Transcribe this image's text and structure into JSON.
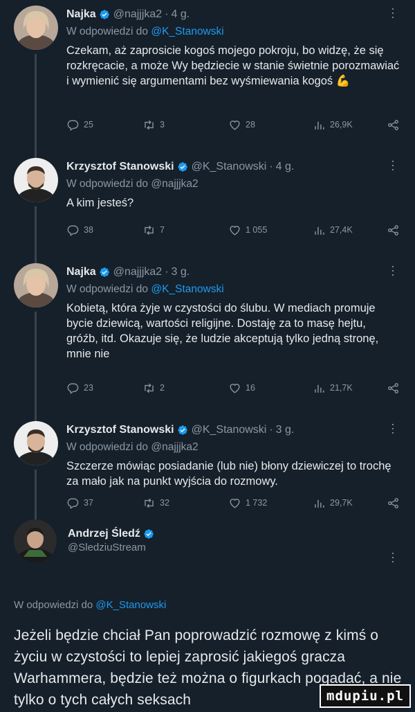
{
  "replying_prefix": "W odpowiedzi do",
  "tweets": [
    {
      "name": "Najka",
      "handle": "@najjjka2",
      "time": "4 g.",
      "reply_to": "@K_Stanowski",
      "reply_to_is_link": true,
      "text": "Czekam, aż zaprosicie kogoś mojego pokroju, bo widzę, że się rozkręcacie, a może Wy będziecie w stanie świetnie porozmawiać i wymienić się argumentami bez wyśmiewania kogoś 💪",
      "replies": "25",
      "retweets": "3",
      "likes": "28",
      "views": "26,9K"
    },
    {
      "name": "Krzysztof Stanowski",
      "handle": "@K_Stanowski",
      "time": "4 g.",
      "reply_to": "@najjjka2",
      "reply_to_is_link": false,
      "text": "A kim jesteś?",
      "replies": "38",
      "retweets": "7",
      "likes": "1 055",
      "views": "27,4K"
    },
    {
      "name": "Najka",
      "handle": "@najjjka2",
      "time": "3 g.",
      "reply_to": "@K_Stanowski",
      "reply_to_is_link": true,
      "text": "Kobietą, która żyje w czystości do ślubu. W mediach promuje bycie dziewicą, wartości religijne. Dostaję za to masę hejtu, gróźb, itd. Okazuje się, że ludzie akceptują tylko jedną stronę, mnie nie",
      "replies": "23",
      "retweets": "2",
      "likes": "16",
      "views": "21,7K"
    },
    {
      "name": "Krzysztof Stanowski",
      "handle": "@K_Stanowski",
      "time": "3 g.",
      "reply_to": "@najjjka2",
      "reply_to_is_link": false,
      "text": "Szczerze mówiąc posiadanie (lub nie) błony dziewiczej to trochę za mało jak na punkt wyjścia do rozmowy.",
      "replies": "37",
      "retweets": "32",
      "likes": "1 732",
      "views": "29,7K"
    }
  ],
  "main_tweet": {
    "name": "Andrzej Śledź",
    "handle": "@SledziuStream",
    "reply_to": "@K_Stanowski",
    "text": "Jeżeli będzie chciał Pan poprowadzić rozmowę z kimś o życiu w czystości to lepiej zaprosić jakiegoś gracza Warhammera, będzie też można o figurkach pogadać, a nie tylko o tych całych seksach"
  },
  "watermark": "mdupiu.pl",
  "colors": {
    "background": "#15202b",
    "text": "#e7e9ea",
    "muted": "#8b98a5",
    "link": "#1d9bf0",
    "thread_line": "#38444d"
  }
}
